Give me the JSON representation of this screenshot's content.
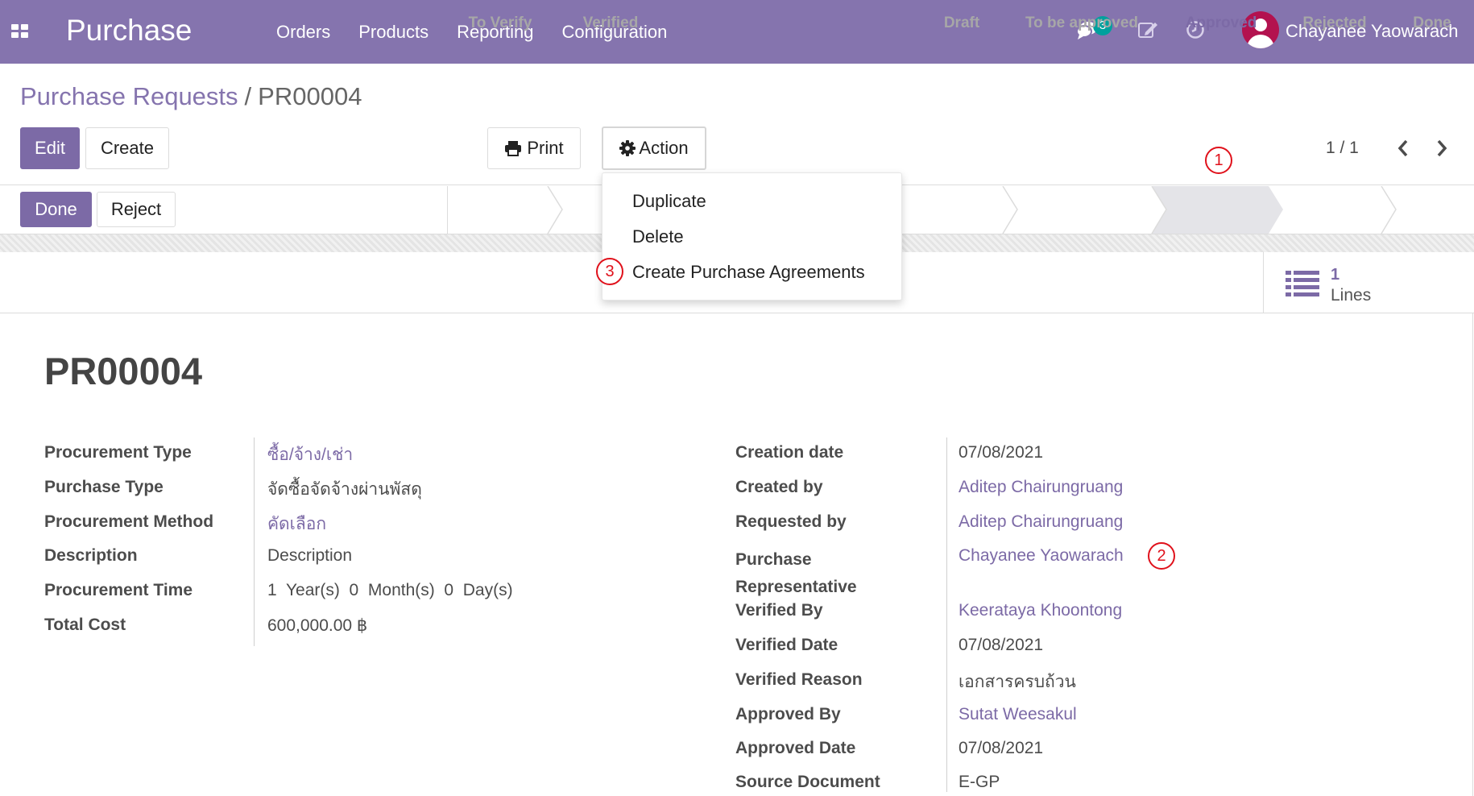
{
  "navbar": {
    "brand": "Purchase",
    "menu": [
      "Orders",
      "Products",
      "Reporting",
      "Configuration"
    ],
    "chat_badge": "3",
    "user_name": "Chayanee Yaowarach",
    "icons": [
      "apps-icon",
      "chat-icon",
      "edit-icon",
      "clock-icon",
      "avatar"
    ]
  },
  "breadcrumb": {
    "parent": "Purchase Requests",
    "separator": "/",
    "current": "PR00004"
  },
  "toolbar": {
    "edit": "Edit",
    "create": "Create",
    "print": "Print",
    "action": "Action",
    "pager": "1 / 1"
  },
  "action_menu": {
    "items": [
      "Duplicate",
      "Delete",
      "Create Purchase Agreements"
    ]
  },
  "statusbar": {
    "done_button": "Done",
    "reject_button": "Reject",
    "stages": [
      "To Verify",
      "Verified",
      "Draft",
      "To be approved",
      "Approved",
      "Rejected",
      "Done"
    ],
    "active_stage": "Approved"
  },
  "smart_button": {
    "count": "1",
    "label": "Lines"
  },
  "record": {
    "title": "PR00004",
    "left_fields": [
      {
        "label": "Procurement Type",
        "value": "ซื้อ/จ้าง/เช่า",
        "link": true
      },
      {
        "label": "Purchase Type",
        "value": "จัดซื้อจัดจ้างผ่านพัสดุ",
        "link": false
      },
      {
        "label": "Procurement Method",
        "value": "คัดเลือก",
        "link": true
      },
      {
        "label": "Description",
        "value": "Description",
        "link": false
      },
      {
        "label": "Procurement Time",
        "value": "1  Year(s)  0  Month(s)  0  Day(s)",
        "link": false
      },
      {
        "label": "Total Cost",
        "value": "600,000.00 ฿",
        "link": false
      }
    ],
    "right_fields": [
      {
        "label": "Creation date",
        "value": "07/08/2021",
        "link": false
      },
      {
        "label": "Created by",
        "value": "Aditep Chairungruang",
        "link": true
      },
      {
        "label": "Requested by",
        "value": "Aditep Chairungruang",
        "link": true
      },
      {
        "label": "Purchase Representative",
        "value": "Chayanee Yaowarach",
        "link": true
      },
      {
        "label": "Verified By",
        "value": "Keerataya Khoontong",
        "link": true
      },
      {
        "label": "Verified Date",
        "value": "07/08/2021",
        "link": false
      },
      {
        "label": "Verified Reason",
        "value": "เอกสารครบถ้วน",
        "link": false
      },
      {
        "label": "Approved By",
        "value": "Sutat Weesakul",
        "link": true
      },
      {
        "label": "Approved Date",
        "value": "07/08/2021",
        "link": false
      },
      {
        "label": "Source Document",
        "value": "E-GP",
        "link": false
      }
    ]
  },
  "annotations": [
    "1",
    "2",
    "3"
  ],
  "colors": {
    "brand": "#8574ae",
    "primary_button": "#7c6aa6",
    "badge": "#00a09d",
    "annotation": "#e0111b"
  }
}
